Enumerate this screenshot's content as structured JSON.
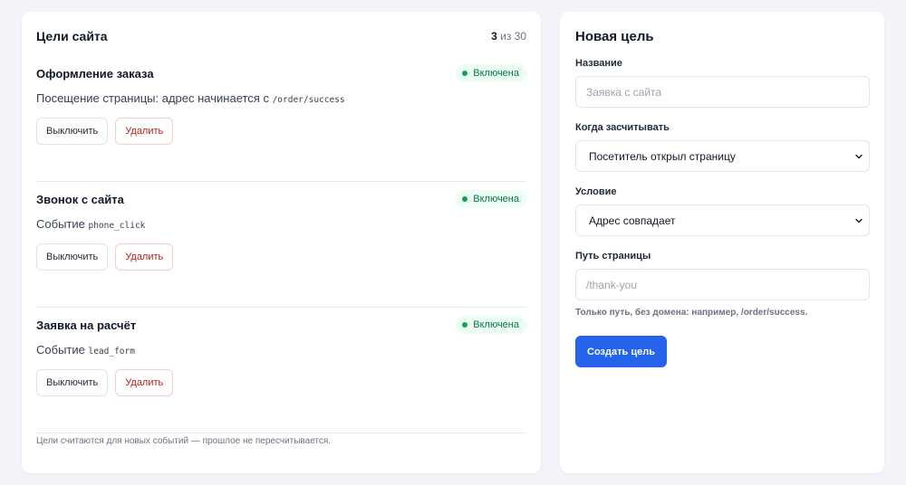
{
  "goals_panel": {
    "title": "Цели сайта",
    "count_current": "3",
    "count_of": "из 30",
    "goals": [
      {
        "name": "Оформление заказа",
        "status": "Включена",
        "desc_prefix": "Посещение страницы: адрес начинается с",
        "desc_code": "/order/success",
        "disable_label": "Выключить",
        "delete_label": "Удалить"
      },
      {
        "name": "Звонок с сайта",
        "status": "Включена",
        "desc_prefix": "Событие",
        "desc_code": "phone_click",
        "disable_label": "Выключить",
        "delete_label": "Удалить"
      },
      {
        "name": "Заявка на расчёт",
        "status": "Включена",
        "desc_prefix": "Событие",
        "desc_code": "lead_form",
        "disable_label": "Выключить",
        "delete_label": "Удалить"
      }
    ],
    "footnote": "Цели считаются для новых событий — прошлое не пересчитывается."
  },
  "new_goal": {
    "title": "Новая цель",
    "name_label": "Название",
    "name_placeholder": "Заявка с сайта",
    "when_label": "Когда засчитывать",
    "when_value": "Посетитель открыл страницу",
    "condition_label": "Условие",
    "condition_value": "Адрес совпадает",
    "path_label": "Путь страницы",
    "path_placeholder": "/thank-you",
    "path_hint": "Только путь, без домена: например, /order/success.",
    "submit_label": "Создать цель"
  },
  "colors": {
    "accent": "#2563eb",
    "status_green": "#067647",
    "danger": "#b42318"
  }
}
